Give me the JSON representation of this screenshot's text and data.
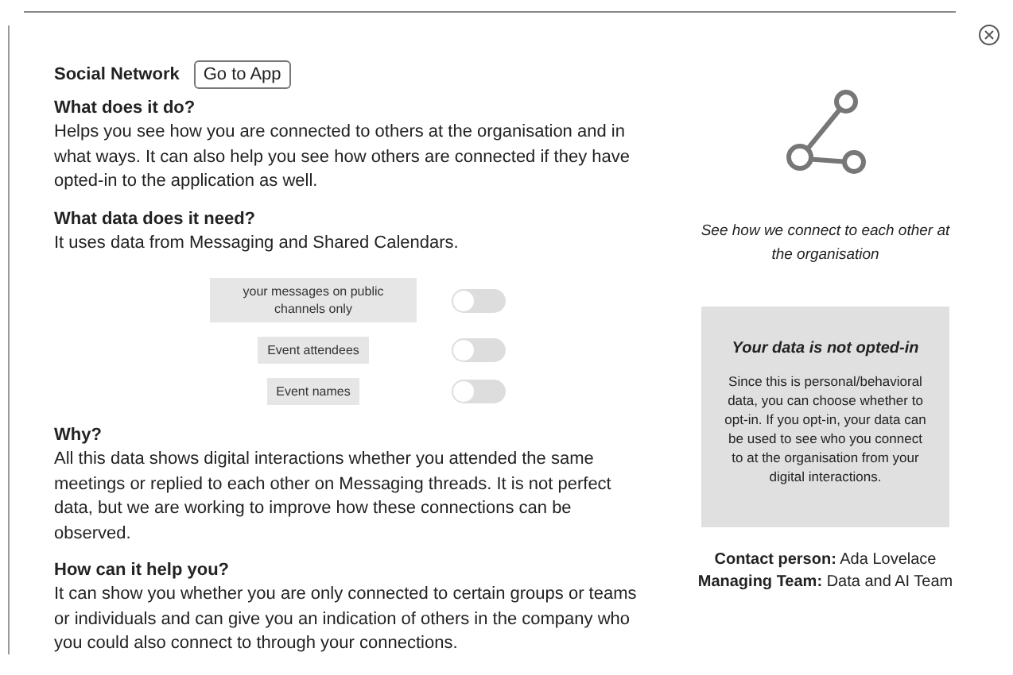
{
  "title": "Social Network",
  "app_button": "Go to App",
  "sections": [
    {
      "heading": "What does it do?",
      "text": "Helps you see how you are connected to others at the organisation and in what ways. It can also help you see how others are connected if they have opted-in to the application as well."
    },
    {
      "heading": "What data does it need?",
      "text": "It uses data from Messaging and Shared Calendars.",
      "toggles": [
        {
          "label": "your messages on public channels only",
          "on": false
        },
        {
          "label": "Event attendees",
          "on": false
        },
        {
          "label": "Event names",
          "on": false
        }
      ]
    },
    {
      "heading": "Why?",
      "text": "All this data shows digital interactions whether you attended the same meetings or replied to each other on Messaging threads. It is not perfect data, but we are working to improve how these connections can be observed."
    },
    {
      "heading": "How can it help you?",
      "text": "It can show you whether you are only connected to certain groups or teams or individuals and can give you an indication of others in the company who you could also connect to through your connections."
    }
  ],
  "caption": "See how we connect to each other at the organisation",
  "notice": {
    "title": "Your data is not opted-in",
    "text": "Since this is personal/behavioral data, you can choose whether to opt-in.  If you opt-in, your data can be used to see who you connect to at the organisation from your digital interactions."
  },
  "contacts": [
    {
      "label": "Contact person:",
      "value": "Ada Lovelace"
    },
    {
      "label": "Managing Team:",
      "value": "Data and AI Team"
    }
  ]
}
